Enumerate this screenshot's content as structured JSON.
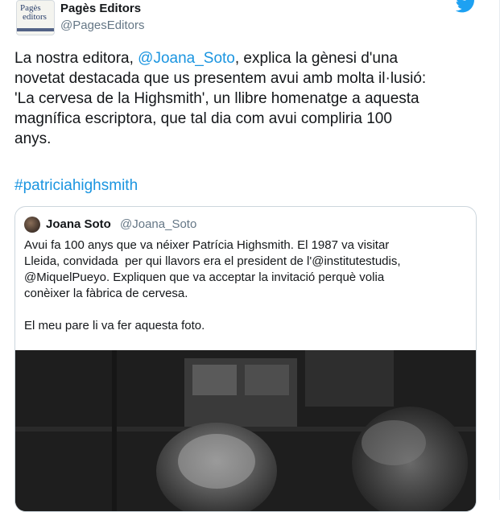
{
  "tweet": {
    "display_name": "Pagès Editors",
    "handle": "@PagesEditors",
    "avatar_lines": [
      "Pagès",
      "editors"
    ],
    "text_before_mention": "La nostra editora, ",
    "mention": "@Joana_Soto",
    "text_after_mention": ", explica la gènesi d'una\nnovetat destacada que us presentem avui amb molta il·lusió:\n'La cervesa de la Highsmith', un llibre homenatge a aquesta\nmagnífica escriptora, que tal dia com avui compliria 100\nanys.",
    "hashtag": "#patriciahighsmith"
  },
  "quoted_tweet": {
    "display_name": "Joana Soto",
    "handle": "@Joana_Soto",
    "text": "Avui fa 100 anys que va néixer Patrícia Highsmith. El 1987 va visitar\nLleida, convidada  per qui llavors era el president de l'@institutestudis,\n@MiquelPueyo. Expliquen que va acceptar la invitació perquè volia\nconèixer la fàbrica de cervesa.\n\nEl meu pare li va fer aquesta foto."
  },
  "colors": {
    "link": "#1b95e0",
    "twitter_blue": "#1da1f2",
    "text": "#14171a",
    "secondary": "#657786",
    "border": "#ccd6dd"
  },
  "icons": [
    "twitter-bird-icon"
  ]
}
